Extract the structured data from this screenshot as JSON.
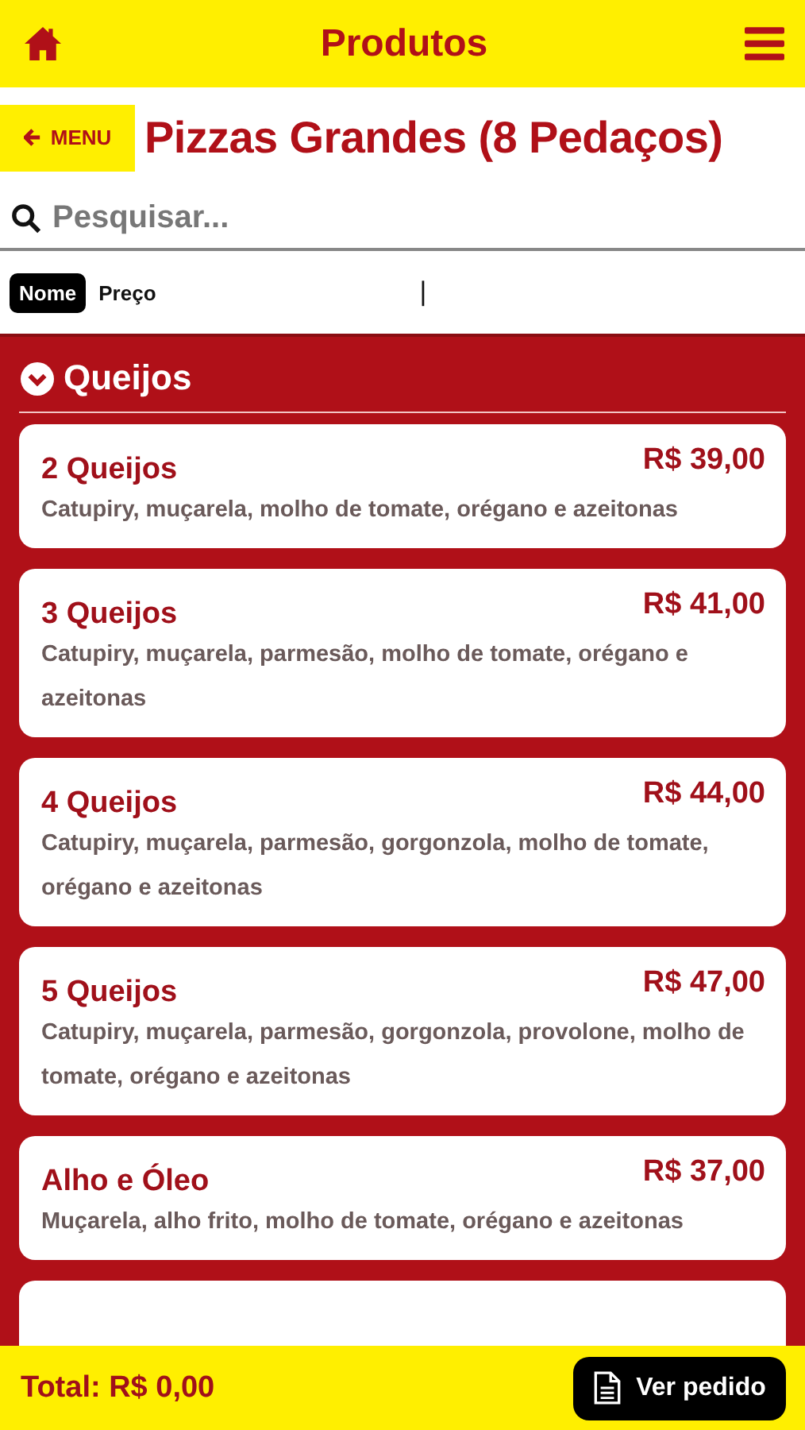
{
  "header": {
    "title": "Produtos"
  },
  "category": {
    "back_label": "MENU",
    "title": "Pizzas Grandes (8 Pedaços)"
  },
  "search": {
    "placeholder": "Pesquisar..."
  },
  "sort": {
    "options": [
      {
        "label": "Nome",
        "selected": true
      },
      {
        "label": "Preço",
        "selected": false
      }
    ],
    "caret": "|"
  },
  "section": {
    "title": "Queijos",
    "expanded": true
  },
  "products": [
    {
      "name": "2 Queijos",
      "price": "R$ 39,00",
      "description": "Catupiry, muçarela, molho de tomate, orégano e azeitonas"
    },
    {
      "name": "3 Queijos",
      "price": "R$ 41,00",
      "description": "Catupiry, muçarela, parmesão, molho de tomate, orégano e azeitonas"
    },
    {
      "name": "4 Queijos",
      "price": "R$ 44,00",
      "description": "Catupiry, muçarela, parmesão, gorgonzola, molho de tomate, orégano e azeitonas"
    },
    {
      "name": "5 Queijos",
      "price": "R$ 47,00",
      "description": "Catupiry, muçarela, parmesão, gorgonzola, provolone, molho de tomate, orégano e azeitonas"
    },
    {
      "name": "Alho e Óleo",
      "price": "R$ 37,00",
      "description": "Muçarela, alho frito, molho de tomate, orégano e azeitonas"
    }
  ],
  "footer": {
    "total": "Total: R$ 0,00",
    "order_button": "Ver pedido"
  }
}
